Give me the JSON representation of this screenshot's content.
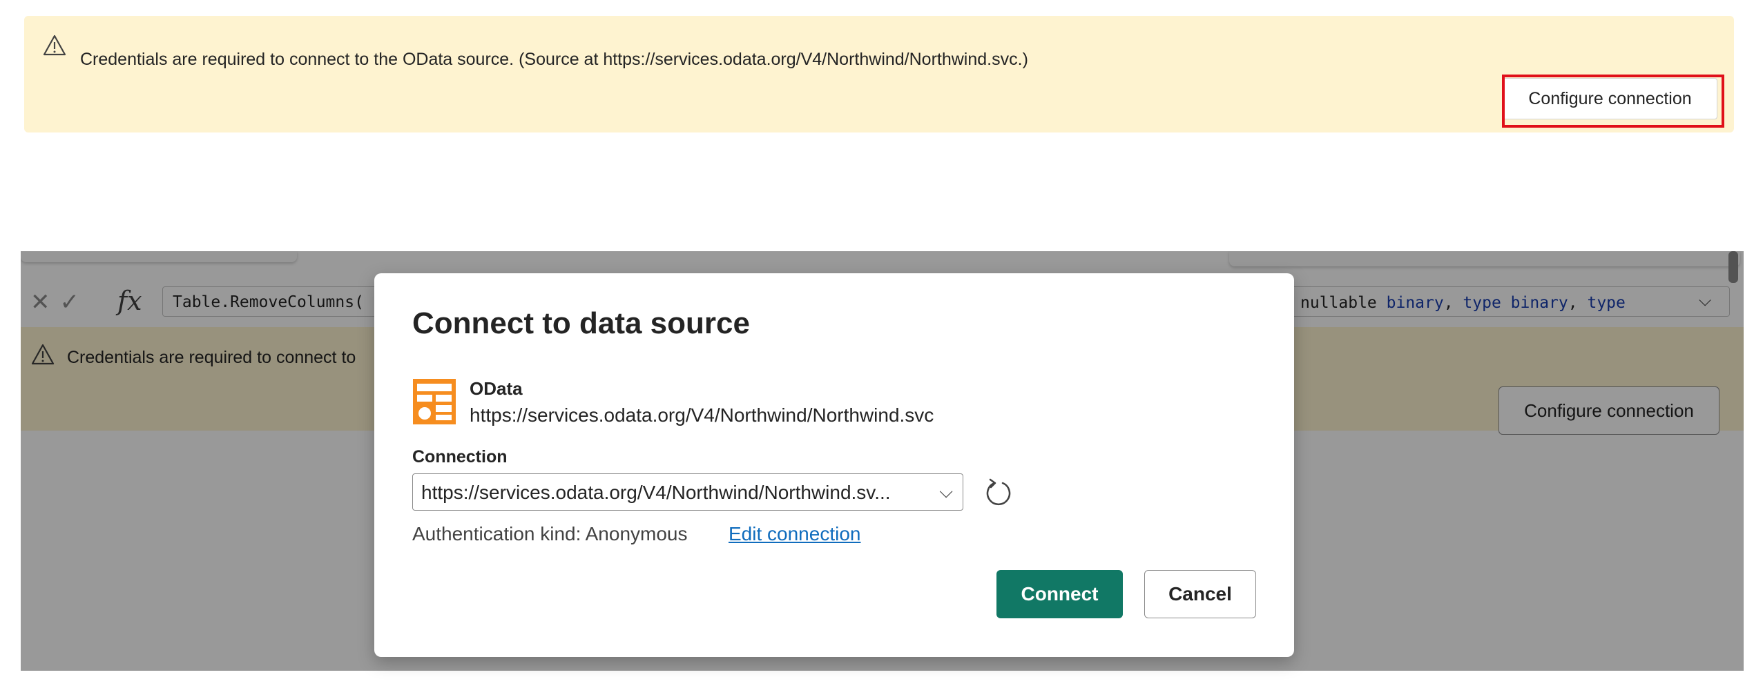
{
  "banner": {
    "message": "Credentials are required to connect to the OData source. (Source at https://services.odata.org/V4/Northwind/Northwind.svc.)",
    "configure_label": "Configure connection",
    "icon": "warning-icon"
  },
  "app": {
    "formula_text": "Table.RemoveColumns(",
    "formula_tail": [
      {
        "t": "nullable ",
        "kw": false
      },
      {
        "t": "binary",
        "kw": true
      },
      {
        "t": ", ",
        "kw": false
      },
      {
        "t": "type",
        "kw": true
      },
      {
        "t": " ",
        "kw": false
      },
      {
        "t": "binary",
        "kw": true
      },
      {
        "t": ", ",
        "kw": false
      },
      {
        "t": "type",
        "kw": true
      }
    ],
    "inner_message": "Credentials are required to connect to",
    "inner_configure_label": "Configure connection"
  },
  "dialog": {
    "title": "Connect to data source",
    "source_name": "OData",
    "source_url": "https://services.odata.org/V4/Northwind/Northwind.svc",
    "connection_label": "Connection",
    "connection_value": "https://services.odata.org/V4/Northwind/Northwind.sv...",
    "auth_text": "Authentication kind: Anonymous",
    "edit_link": "Edit connection",
    "connect_label": "Connect",
    "cancel_label": "Cancel"
  },
  "colors": {
    "banner_bg": "#fef3d0",
    "highlight": "#e0101a",
    "primary": "#117865",
    "link": "#0f6cbd",
    "odata_orange": "#f68d1f"
  }
}
